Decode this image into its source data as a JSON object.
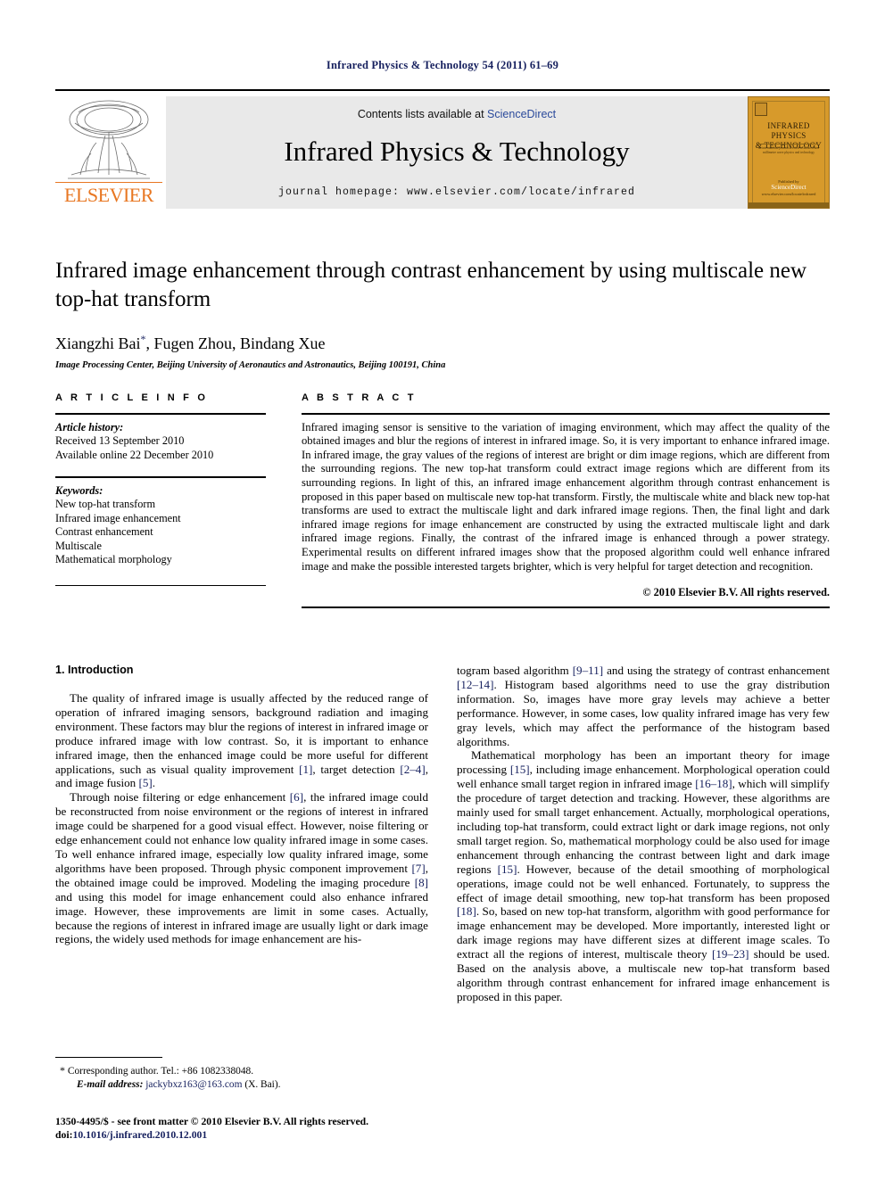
{
  "running_head": "Infrared Physics & Technology 54 (2011) 61–69",
  "masthead": {
    "contents_prefix": "Contents lists available at",
    "contents_link": "ScienceDirect",
    "journal_title": "Infrared Physics & Technology",
    "homepage": "journal homepage: www.elsevier.com/locate/infrared",
    "publisher_name": "ELSEVIER",
    "cover": {
      "title_line1": "INFRARED PHYSICS",
      "title_line2": "& TECHNOLOGY",
      "subtitle": "an international journal devoted to infrared and millimetre wave physics and technology",
      "footer_small": "Published by",
      "footer_big": "ScienceDirect",
      "footer_url": "www.elsevier.com/locate/infrared"
    }
  },
  "article": {
    "title": "Infrared image enhancement through contrast enhancement by using multiscale new top-hat transform",
    "authors": "Xiangzhi Bai",
    "authors_rest": ", Fugen Zhou, Bindang Xue",
    "corresponding_marker": "*",
    "affiliation": "Image Processing Center, Beijing University of Aeronautics and Astronautics, Beijing 100191, China"
  },
  "article_info": {
    "heading": "A R T I C L E   I N F O",
    "history_label": "Article history:",
    "history": [
      "Received 13 September 2010",
      "Available online 22 December 2010"
    ],
    "keywords_label": "Keywords:",
    "keywords": [
      "New top-hat transform",
      "Infrared image enhancement",
      "Contrast enhancement",
      "Multiscale",
      "Mathematical morphology"
    ]
  },
  "abstract": {
    "heading": "A B S T R A C T",
    "text": "Infrared imaging sensor is sensitive to the variation of imaging environment, which may affect the quality of the obtained images and blur the regions of interest in infrared image. So, it is very important to enhance infrared image. In infrared image, the gray values of the regions of interest are bright or dim image regions, which are different from the surrounding regions. The new top-hat transform could extract image regions which are different from its surrounding regions. In light of this, an infrared image enhancement algorithm through contrast enhancement is proposed in this paper based on multiscale new top-hat transform. Firstly, the multiscale white and black new top-hat transforms are used to extract the multiscale light and dark infrared image regions. Then, the final light and dark infrared image regions for image enhancement are constructed by using the extracted multiscale light and dark infrared image regions. Finally, the contrast of the infrared image is enhanced through a power strategy. Experimental results on different infrared images show that the proposed algorithm could well enhance infrared image and make the possible interested targets brighter, which is very helpful for target detection and recognition.",
    "copyright": "© 2010 Elsevier B.V. All rights reserved."
  },
  "body": {
    "section_heading": "1. Introduction",
    "left_paragraphs": [
      "The quality of infrared image is usually affected by the reduced range of operation of infrared imaging sensors, background radiation and imaging environment. These factors may blur the regions of interest in infrared image or produce infrared image with low contrast. So, it is important to enhance infrared image, then the enhanced image could be more useful for different applications, such as visual quality improvement [1], target detection [2–4], and image fusion [5].",
      "Through noise filtering or edge enhancement [6], the infrared image could be reconstructed from noise environment or the regions of interest in infrared image could be sharpened for a good visual effect. However, noise filtering or edge enhancement could not enhance low quality infrared image in some cases. To well enhance infrared image, especially low quality infrared image, some algorithms have been proposed. Through physic component improvement [7], the obtained image could be improved. Modeling the imaging procedure [8] and using this model for image enhancement could also enhance infrared image. However, these improvements are limit in some cases. Actually, because the regions of interest in infrared image are usually light or dark image regions, the widely used methods for image enhancement are his-"
    ],
    "right_paragraphs": [
      "togram based algorithm [9–11] and using the strategy of contrast enhancement [12–14]. Histogram based algorithms need to use the gray distribution information. So, images have more gray levels may achieve a better performance. However, in some cases, low quality infrared image has very few gray levels, which may affect the performance of the histogram based algorithms.",
      "Mathematical morphology has been an important theory for image processing [15], including image enhancement. Morphological operation could well enhance small target region in infrared image [16–18], which will simplify the procedure of target detection and tracking. However, these algorithms are mainly used for small target enhancement. Actually, morphological operations, including top-hat transform, could extract light or dark image regions, not only small target region. So, mathematical morphology could be also used for image enhancement through enhancing the contrast between light and dark image regions [15]. However, because of the detail smoothing of morphological operations, image could not be well enhanced. Fortunately, to suppress the effect of image detail smoothing, new top-hat transform has been proposed [18]. So, based on new top-hat transform, algorithm with good performance for image enhancement may be developed. More importantly, interested light or dark image regions may have different sizes at different image scales. To extract all the regions of interest, multiscale theory [19–23] should be used. Based on the analysis above, a multiscale new top-hat transform based algorithm through contrast enhancement for infrared image enhancement is proposed in this paper."
    ]
  },
  "footnotes": {
    "corresponding": "Corresponding author. Tel.: +86 1082338048.",
    "email_label": "E-mail address:",
    "email": "jackybxz163@163.com",
    "email_suffix": "(X. Bai).",
    "issn_line": "1350-4495/$ - see front matter © 2010 Elsevier B.V. All rights reserved.",
    "doi_label": "doi:",
    "doi": "10.1016/j.infrared.2010.12.001"
  },
  "colors": {
    "link": "#16205e",
    "sciencedirect": "#2b4a9b",
    "elsevier_orange": "#e87722",
    "band_gray": "#e9e9e9",
    "cover_gold": "#d79a2b"
  }
}
